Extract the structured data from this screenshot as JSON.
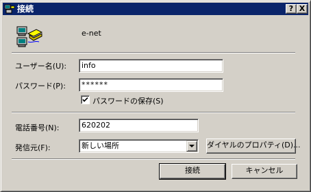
{
  "window": {
    "title": "接続",
    "help_label": "?",
    "close_label": "X"
  },
  "connection": {
    "name": "e-net",
    "icon": "computer-phone-icon"
  },
  "username": {
    "label": "ユーザー名(U):",
    "value": "info"
  },
  "password": {
    "label": "パスワード(P):",
    "value": "******"
  },
  "save_password": {
    "label": "パスワードの保存(S)",
    "checked": true
  },
  "phone": {
    "label": "電話番号(N):",
    "value": "620202"
  },
  "dial_from": {
    "label": "発信元(F):",
    "selected": "新しい場所"
  },
  "buttons": {
    "dialing_properties": "ダイヤルのプロパティ(D)...",
    "connect": "接続",
    "cancel": "キャンセル"
  },
  "colors": {
    "titlebar": "#0a246a",
    "face": "#d4d0c8"
  }
}
